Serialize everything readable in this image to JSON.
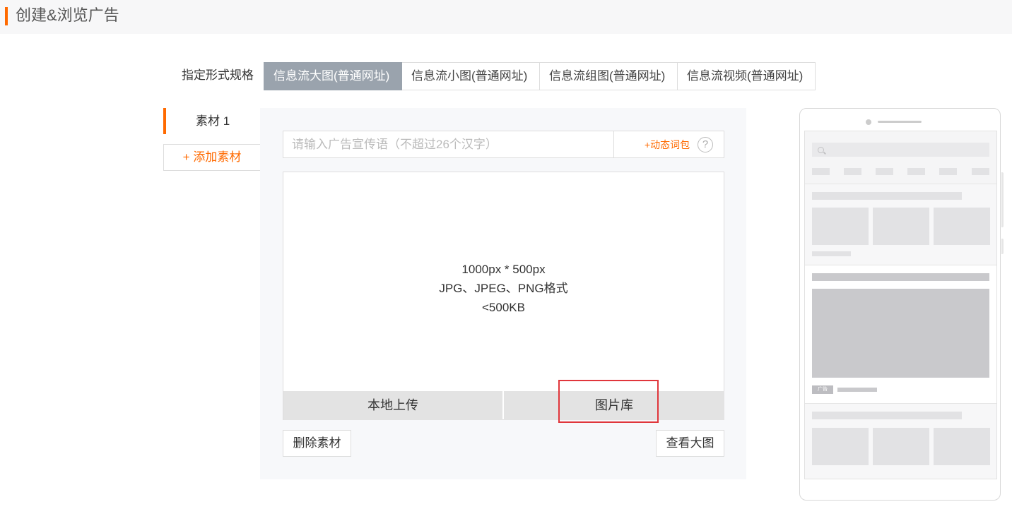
{
  "header": {
    "title": "创建&浏览广告",
    "accent_color": "#ff6a00"
  },
  "spec": {
    "label": "指定形式规格",
    "tabs": [
      {
        "label": "信息流大图(普通网址)",
        "active": true
      },
      {
        "label": "信息流小图(普通网址)",
        "active": false
      },
      {
        "label": "信息流组图(普通网址)",
        "active": false
      },
      {
        "label": "信息流视频(普通网址)",
        "active": false
      }
    ]
  },
  "materials": {
    "item_label": "素材 1",
    "add_label": "+ 添加素材"
  },
  "editor": {
    "ad_text_placeholder": "请输入广告宣传语（不超过26个汉字）",
    "ad_text_value": "",
    "dynamic_words_label": "+动态词包",
    "help_icon": "question-circle-icon",
    "help_glyph": "?",
    "image_spec": [
      "1000px * 500px",
      "JPG、JPEG、PNG格式",
      "<500KB"
    ],
    "local_upload_label": "本地上传",
    "image_library_label": "图片库",
    "delete_label": "删除素材",
    "view_large_label": "查看大图"
  },
  "preview": {
    "ad_tag": "广告"
  }
}
